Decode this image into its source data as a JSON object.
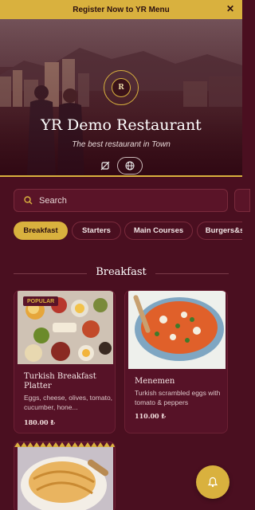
{
  "banner": {
    "text": "Register Now to YR Menu"
  },
  "hero": {
    "title": "YR Demo Restaurant",
    "subtitle": "The best restaurant in Town",
    "logo_letter": "R"
  },
  "search": {
    "placeholder": "Search"
  },
  "tabs": [
    {
      "label": "Breakfast",
      "active": true
    },
    {
      "label": "Starters",
      "active": false
    },
    {
      "label": "Main Courses",
      "active": false
    },
    {
      "label": "Burgers&s",
      "active": false
    }
  ],
  "section": {
    "title": "Breakfast"
  },
  "items": [
    {
      "name": "Turkish Breakfast Platter",
      "description": "Eggs, cheese, olives, tomato, cucumber, hone...",
      "price": "180.00 ₺",
      "badge": "POPULAR"
    },
    {
      "name": "Menemen",
      "description": "Turkish scrambled eggs with tomato & peppers",
      "price": "110.00 ₺"
    }
  ],
  "colors": {
    "accent": "#d9b13e",
    "background": "#4a0f20",
    "card": "#561227"
  },
  "icons": {
    "close": "close-icon",
    "search": "search-icon",
    "no-allergen": "no-allergen-icon",
    "globe": "globe-icon",
    "bell": "bell-icon"
  }
}
